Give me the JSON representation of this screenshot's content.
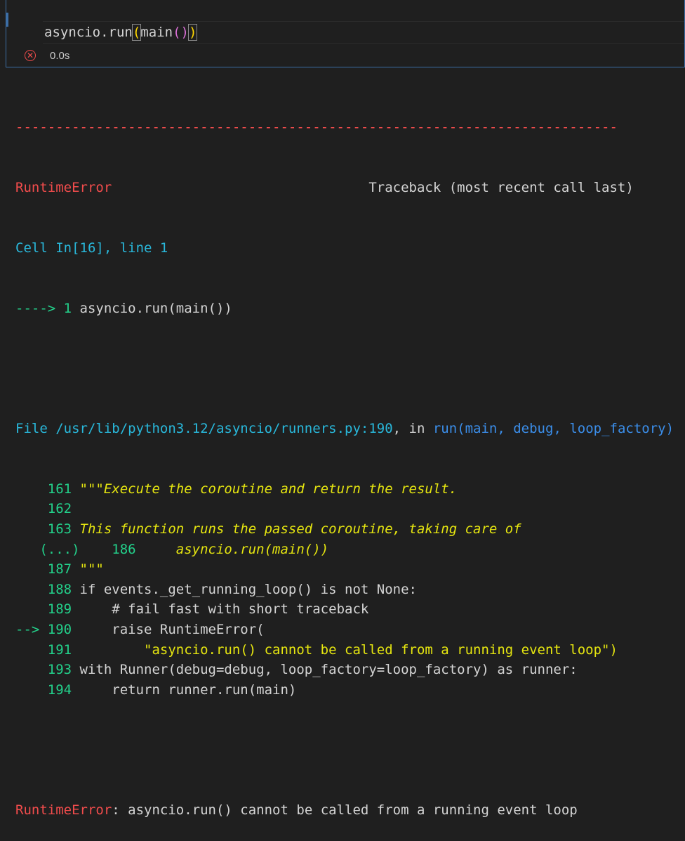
{
  "cell": {
    "code_prefix": "asyncio.run",
    "paren_open": "(",
    "code_mid": "main",
    "inner_parens": "()",
    "paren_close": ")",
    "status_time": "0.0s"
  },
  "traceback": {
    "separator": "---------------------------------------------------------------------------",
    "error_name": "RuntimeError",
    "header_spaces": "                                ",
    "header_right": "Traceback (most recent call last)",
    "cell_ref": "Cell In[16], line 1",
    "arrow1": "----> 1 ",
    "arrow1_code": "asyncio.run(main())",
    "file_prefix": "File ",
    "file_path": "/usr/lib/python3.12/asyncio/runners.py:190",
    "file_in": ", in ",
    "func_name": "run",
    "func_args": "(main, debug, loop_factory)",
    "lines": [
      {
        "num": "    161 ",
        "code": "\"\"\"Execute the coroutine and return the result.",
        "style": "yellow"
      },
      {
        "num": "    162",
        "code": "",
        "style": "plain"
      },
      {
        "num": "    163 ",
        "code": "This function runs the passed coroutine, taking care of",
        "style": "yellow"
      },
      {
        "num": "   (...)    186 ",
        "code": "    asyncio.run(main())",
        "style": "yellow"
      },
      {
        "num": "    187 ",
        "code": "\"\"\"",
        "style": "yellow"
      },
      {
        "num": "    188 ",
        "code": "if events._get_running_loop() is not None:",
        "style": "plain"
      },
      {
        "num": "    189 ",
        "code": "    # fail fast with short traceback",
        "style": "plain"
      },
      {
        "num": "--> 190 ",
        "code": "    raise RuntimeError(",
        "style": "plain"
      },
      {
        "num": "    191 ",
        "code": "        \"asyncio.run() cannot be called from a running event loop\")",
        "style": "string"
      },
      {
        "num": "    193 ",
        "code": "with Runner(debug=debug, loop_factory=loop_factory) as runner:",
        "style": "plain"
      },
      {
        "num": "    194 ",
        "code": "    return runner.run(main)",
        "style": "plain"
      }
    ],
    "final_error_name": "RuntimeError",
    "final_message": ": asyncio.run() cannot be called from a running event loop"
  }
}
